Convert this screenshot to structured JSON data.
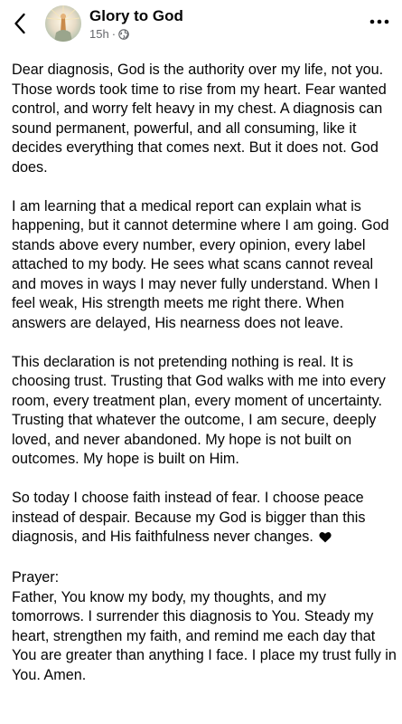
{
  "header": {
    "back_icon": "chevron-left-icon",
    "page_name": "Glory to God",
    "timestamp": "15h",
    "separator": "·",
    "audience_icon": "globe-icon",
    "more_icon": "more-horizontal-icon"
  },
  "post": {
    "paragraphs": [
      "Dear diagnosis, God is the authority over my life, not you. Those words took time to rise from my heart. Fear wanted control, and worry felt heavy in my chest. A diagnosis can sound permanent, powerful, and all consuming, like it decides everything that comes next. But it does not. God does.",
      "I am learning that a medical report can explain what is happening, but it cannot determine where I am going. God stands above every number, every opinion, every label attached to my body. He sees what scans cannot reveal and moves in ways I may never fully understand. When I feel weak, His strength meets me right there. When answers are delayed, His nearness does not leave.",
      "This declaration is not pretending nothing is real. It is choosing trust. Trusting that God walks with me into every room, every treatment plan, every moment of uncertainty. Trusting that whatever the outcome, I am secure, deeply loved, and never abandoned. My hope is not built on outcomes. My hope is built on Him.",
      "So today I choose faith instead of fear. I choose peace instead of despair. Because my God is bigger than this diagnosis, and His faithfulness never changes."
    ],
    "emoji_icon": "black-heart-icon",
    "prayer_label": "Prayer:",
    "prayer_text": "Father, You know my body, my thoughts, and my tomorrows. I surrender this diagnosis to You. Steady my heart, strengthen my faith, and remind me each day that You are greater than anything I face. I place my trust fully in You. Amen."
  },
  "colors": {
    "text": "#050505",
    "secondary_text": "#65676b",
    "background": "#ffffff"
  }
}
